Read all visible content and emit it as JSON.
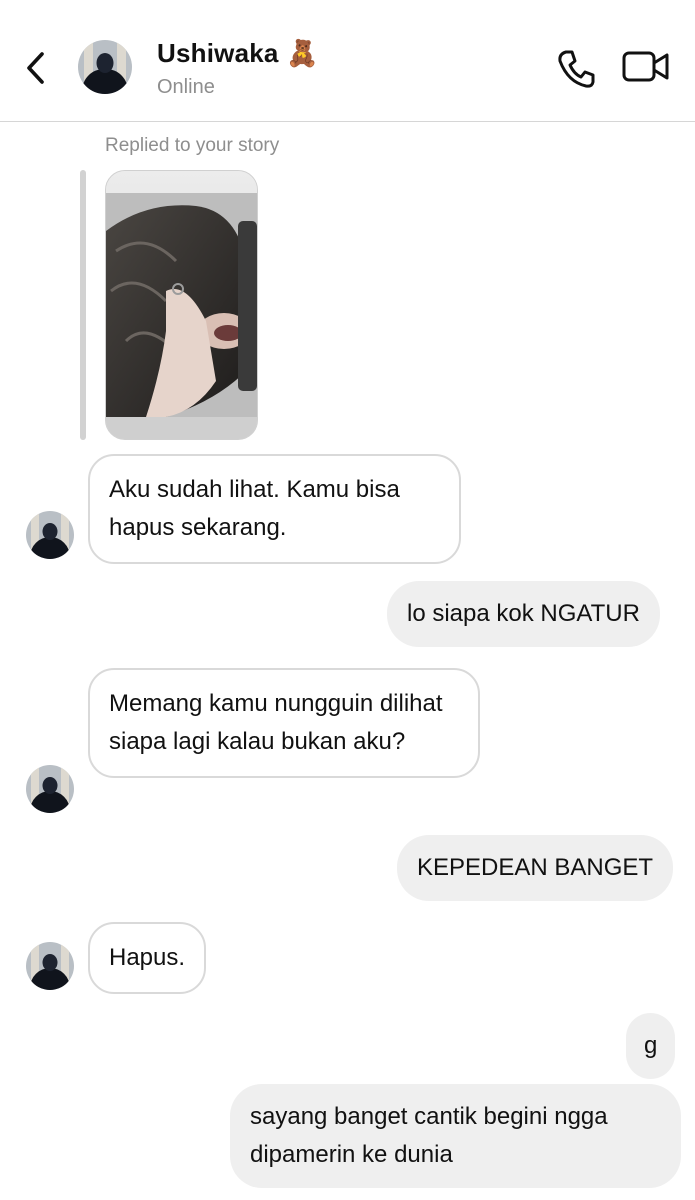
{
  "header": {
    "contact_name": "Ushiwaka",
    "contact_emoji": "🧸",
    "status": "Online"
  },
  "reply": {
    "note": "Replied to your story"
  },
  "messages": [
    {
      "sender": "them",
      "text": "Aku sudah lihat. Kamu bisa hapus sekarang."
    },
    {
      "sender": "me",
      "text": "lo siapa kok NGATUR"
    },
    {
      "sender": "them",
      "text": "Memang kamu nungguin dilihat siapa lagi kalau bukan aku?"
    },
    {
      "sender": "me",
      "text": "KEPEDEAN BANGET"
    },
    {
      "sender": "them",
      "text": "Hapus."
    },
    {
      "sender": "me",
      "text": "g"
    },
    {
      "sender": "me",
      "text": "sayang banget cantik begini ngga dipamerin ke dunia"
    }
  ],
  "colors": {
    "sent_bubble": "#efefef",
    "received_border": "#d9d9d9",
    "muted_text": "#8e8e8e"
  },
  "icons": [
    "back-arrow",
    "phone",
    "video-camera"
  ]
}
